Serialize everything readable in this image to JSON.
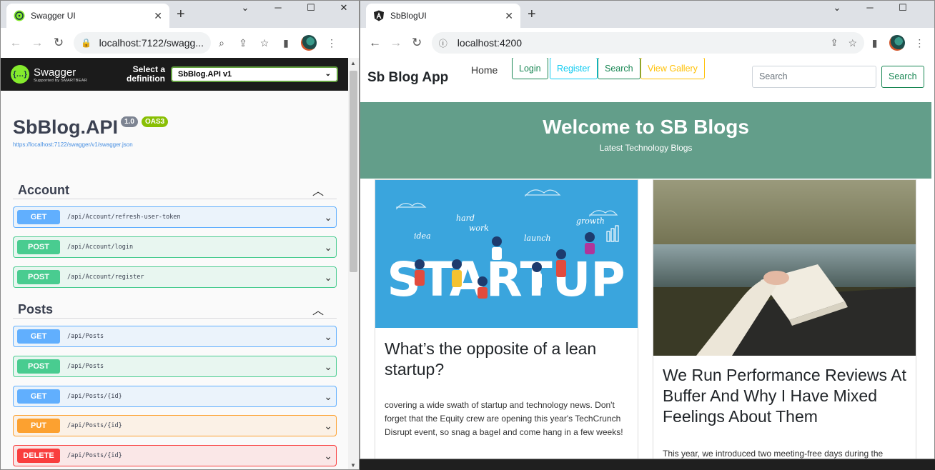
{
  "left_window": {
    "tab_title": "Swagger UI",
    "address": "localhost:7122/swagg...",
    "page": {
      "brand_name": "Swagger",
      "brand_sub": "Supported by SMARTBEAR",
      "select_label_line1": "Select a",
      "select_label_line2": "definition",
      "select_value": "SbBlog.API v1",
      "api_title": "SbBlog.API",
      "version_badge": "1.0",
      "oas_badge": "OAS3",
      "spec_url": "https://localhost:7122/swagger/v1/swagger.json",
      "sections": [
        {
          "name": "Account",
          "operations": [
            {
              "method": "GET",
              "path": "/api/Account/refresh-user-token"
            },
            {
              "method": "POST",
              "path": "/api/Account/login"
            },
            {
              "method": "POST",
              "path": "/api/Account/register"
            }
          ]
        },
        {
          "name": "Posts",
          "operations": [
            {
              "method": "GET",
              "path": "/api/Posts"
            },
            {
              "method": "POST",
              "path": "/api/Posts"
            },
            {
              "method": "GET",
              "path": "/api/Posts/{id}"
            },
            {
              "method": "PUT",
              "path": "/api/Posts/{id}"
            },
            {
              "method": "DELETE",
              "path": "/api/Posts/{id}"
            }
          ]
        }
      ]
    }
  },
  "right_window": {
    "tab_title": "SbBlogUI",
    "address": "localhost:4200",
    "page": {
      "brand": "Sb Blog App",
      "nav_home": "Home",
      "nav_buttons": [
        "Login",
        "Register",
        "Search",
        "View Gallery"
      ],
      "search_placeholder": "Search",
      "search_button": "Search",
      "hero_title": "Welcome to SB Blogs",
      "hero_subtitle": "Latest Technology Blogs",
      "cards": [
        {
          "image_words": [
            "hard",
            "work",
            "growth",
            "idea",
            "launch",
            "STARTUP"
          ],
          "title": "What’s the opposite of a lean startup?",
          "body": "covering a wide swath of startup and technology news. Don't forget that the Equity crew are opening this year's TechCrunch Disrupt event, so snag a bagel and come hang in a few weeks!"
        },
        {
          "title": "We Run Performance Reviews At Buffer And Why I Have Mixed Feelings About Them",
          "body": "This year, we introduced two meeting-free days during the"
        }
      ]
    }
  },
  "colors": {
    "swagger_green": "#85ea2d",
    "get": "#61affe",
    "post": "#49cc90",
    "put": "#fca130",
    "delete": "#f93e3e",
    "hero_bg": "#639e8a",
    "startup_bg": "#3aa5dd"
  }
}
